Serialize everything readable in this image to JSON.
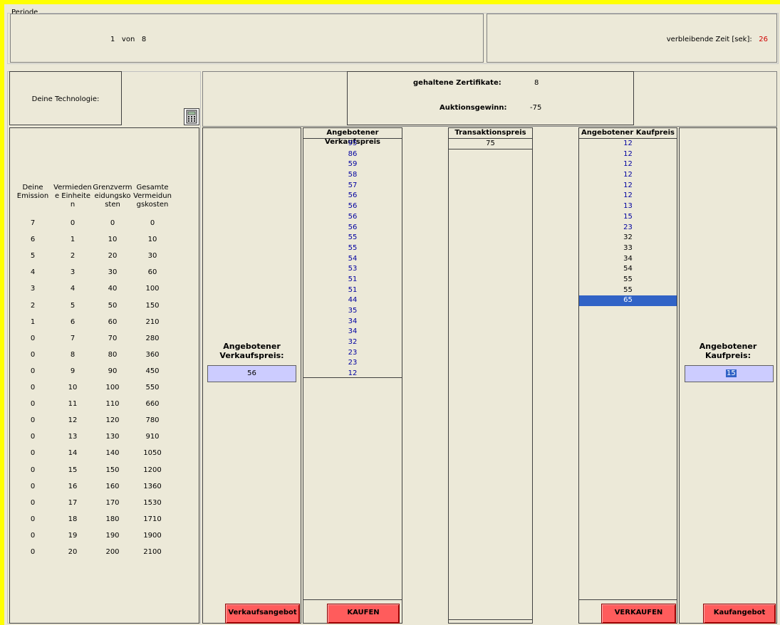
{
  "periode": {
    "legend": "Periode",
    "current": "1",
    "von": "von",
    "total": "8"
  },
  "timer": {
    "label": "verbleibende Zeit [sek]:",
    "value": "26",
    "value_color": "#d00000"
  },
  "technologie": {
    "label": "Deine Technologie:",
    "calculator_icon": "calculator-icon"
  },
  "summary": {
    "zertifikate_label": "gehaltene Zertifikate:",
    "zertifikate_value": "8",
    "gewinn_label": "Auktionsgewinn:",
    "gewinn_value": "-75"
  },
  "cost_table": {
    "headers": [
      "Deine\nEmission",
      "Vermieden\ne Einheite\nn",
      "Grenzverm\neidungsko\nsten",
      "Gesamte\nVermeidun\ngskosten"
    ],
    "rows": [
      [
        "7",
        "0",
        "0",
        "0"
      ],
      [
        "6",
        "1",
        "10",
        "10"
      ],
      [
        "5",
        "2",
        "20",
        "30"
      ],
      [
        "4",
        "3",
        "30",
        "60"
      ],
      [
        "3",
        "4",
        "40",
        "100"
      ],
      [
        "2",
        "5",
        "50",
        "150"
      ],
      [
        "1",
        "6",
        "60",
        "210"
      ],
      [
        "0",
        "7",
        "70",
        "280"
      ],
      [
        "0",
        "8",
        "80",
        "360"
      ],
      [
        "0",
        "9",
        "90",
        "450"
      ],
      [
        "0",
        "10",
        "100",
        "550"
      ],
      [
        "0",
        "11",
        "110",
        "660"
      ],
      [
        "0",
        "12",
        "120",
        "780"
      ],
      [
        "0",
        "13",
        "130",
        "910"
      ],
      [
        "0",
        "14",
        "140",
        "1050"
      ],
      [
        "0",
        "15",
        "150",
        "1200"
      ],
      [
        "0",
        "16",
        "160",
        "1360"
      ],
      [
        "0",
        "17",
        "170",
        "1530"
      ],
      [
        "0",
        "18",
        "180",
        "1710"
      ],
      [
        "0",
        "19",
        "190",
        "1900"
      ],
      [
        "0",
        "20",
        "200",
        "2100"
      ]
    ]
  },
  "sell_offer": {
    "label_line1": "Angebotener",
    "label_line2": "Verkaufspreis:",
    "value": "56",
    "button": "Verkaufsangebot"
  },
  "sell_list": {
    "header": "Angebotener Verkaufspreis",
    "items": [
      "95",
      "86",
      "59",
      "58",
      "57",
      "56",
      "56",
      "56",
      "56",
      "55",
      "55",
      "54",
      "53",
      "51",
      "51",
      "44",
      "35",
      "34",
      "34",
      "32",
      "23",
      "23",
      "12"
    ],
    "button": "KAUFEN"
  },
  "transaction_list": {
    "header": "Transaktionspreis",
    "items": [
      "75"
    ]
  },
  "buy_list": {
    "header": "Angebotener Kaufpreis",
    "items": [
      "12",
      "12",
      "12",
      "12",
      "12",
      "12",
      "13",
      "15",
      "23",
      "32",
      "33",
      "34",
      "54",
      "55",
      "55",
      "65"
    ],
    "blue_count": 9,
    "selected_index": 15,
    "button": "VERKAUFEN"
  },
  "buy_offer": {
    "label_line1": "Angebotener",
    "label_line2": "Kaufpreis:",
    "value": "15",
    "button": "Kaufangebot"
  }
}
